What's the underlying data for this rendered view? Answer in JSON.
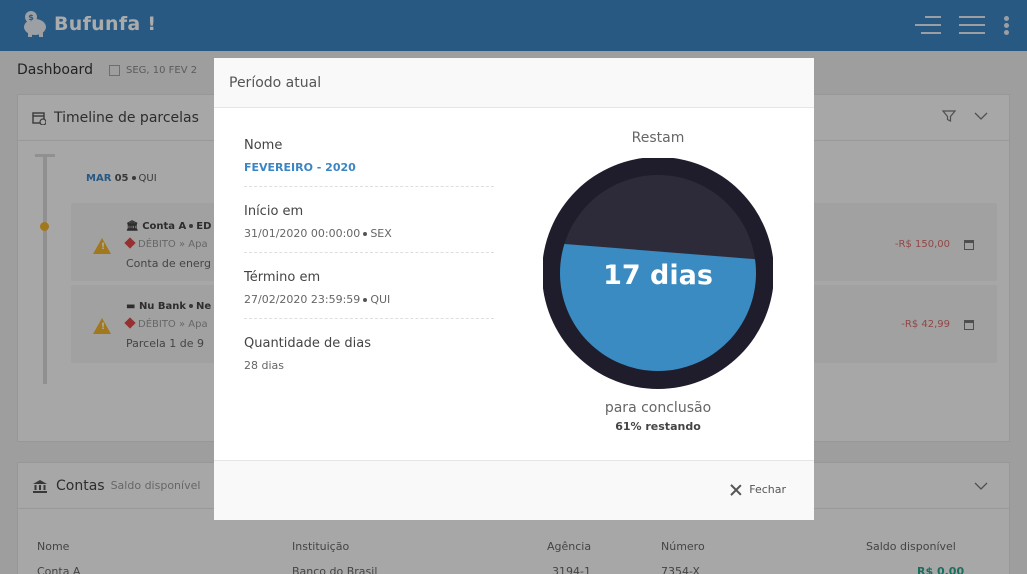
{
  "app": {
    "name": "Bufunfa !"
  },
  "breadcrumb": {
    "title": "Dashboard",
    "date": "SEG, 10 FEV 2"
  },
  "timeline": {
    "title": "Timeline de parcelas",
    "date_month": "MAR",
    "date_day": "05",
    "date_weekday": "QUI",
    "items": [
      {
        "account": "Conta A",
        "account_suffix": "ED",
        "category": "DÉBITO » Apa",
        "description": "Conta de energ",
        "amount": "-R$ 150,00"
      },
      {
        "account": "Nu Bank",
        "account_suffix": "Ne",
        "category": "DÉBITO » Apa",
        "description": "Parcela 1 de 9",
        "amount": "-R$ 42,99"
      }
    ]
  },
  "accounts": {
    "title": "Contas",
    "subtitle": "Saldo disponível",
    "columns": [
      "Nome",
      "Instituição",
      "Agência",
      "Número",
      "Saldo disponível"
    ],
    "rows": [
      {
        "nome": "Conta A",
        "instituicao": "Banco do Brasil",
        "agencia": "3194-1",
        "numero": "7354-X",
        "saldo": "R$ 0,00"
      }
    ]
  },
  "modal": {
    "title": "Período atual",
    "fields": [
      {
        "label": "Nome",
        "value": "FEVEREIRO - 2020"
      },
      {
        "label": "Início em",
        "value": "31/01/2020 00:00:00",
        "weekday": "SEX"
      },
      {
        "label": "Término em",
        "value": "27/02/2020 23:59:59",
        "weekday": "QUI"
      },
      {
        "label": "Quantidade de dias",
        "value": "28 dias"
      }
    ],
    "gauge": {
      "top_label": "Restam",
      "center_value": "17 dias",
      "bottom_label": "para conclusão",
      "percent_text": "61% restando",
      "fill_fraction": 0.61,
      "fill_color": "#3a8bc1",
      "ring_color": "#1f1d2b",
      "bg_color": "#2d2b3a"
    },
    "close_label": "Fechar"
  },
  "colors": {
    "header": "#3b85c3",
    "accent": "#3b85c3",
    "debit": "#d86a6a",
    "warning": "#f0b429",
    "balance": "#2aa58a"
  }
}
